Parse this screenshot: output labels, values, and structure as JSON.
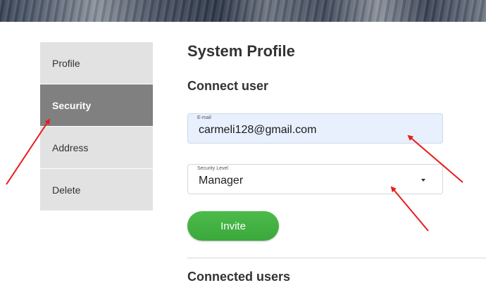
{
  "sidebar": {
    "items": [
      {
        "label": "Profile"
      },
      {
        "label": "Security"
      },
      {
        "label": "Address"
      },
      {
        "label": "Delete"
      }
    ]
  },
  "main": {
    "title": "System Profile",
    "connect_section": {
      "title": "Connect user",
      "email": {
        "label": "E-mail",
        "value": "carmeli128@gmail.com"
      },
      "security_level": {
        "label": "Security Level",
        "value": "Manager"
      },
      "invite_label": "Invite"
    },
    "connected_section": {
      "title": "Connected users"
    }
  },
  "colors": {
    "accent_green": "#43b243",
    "sidebar_active": "#808080",
    "sidebar_bg": "#e2e2e2",
    "autofill_bg": "#e8f0fe",
    "annotation_red": "#e81c1c"
  },
  "icons": {
    "dropdown": "caret-down-icon"
  }
}
